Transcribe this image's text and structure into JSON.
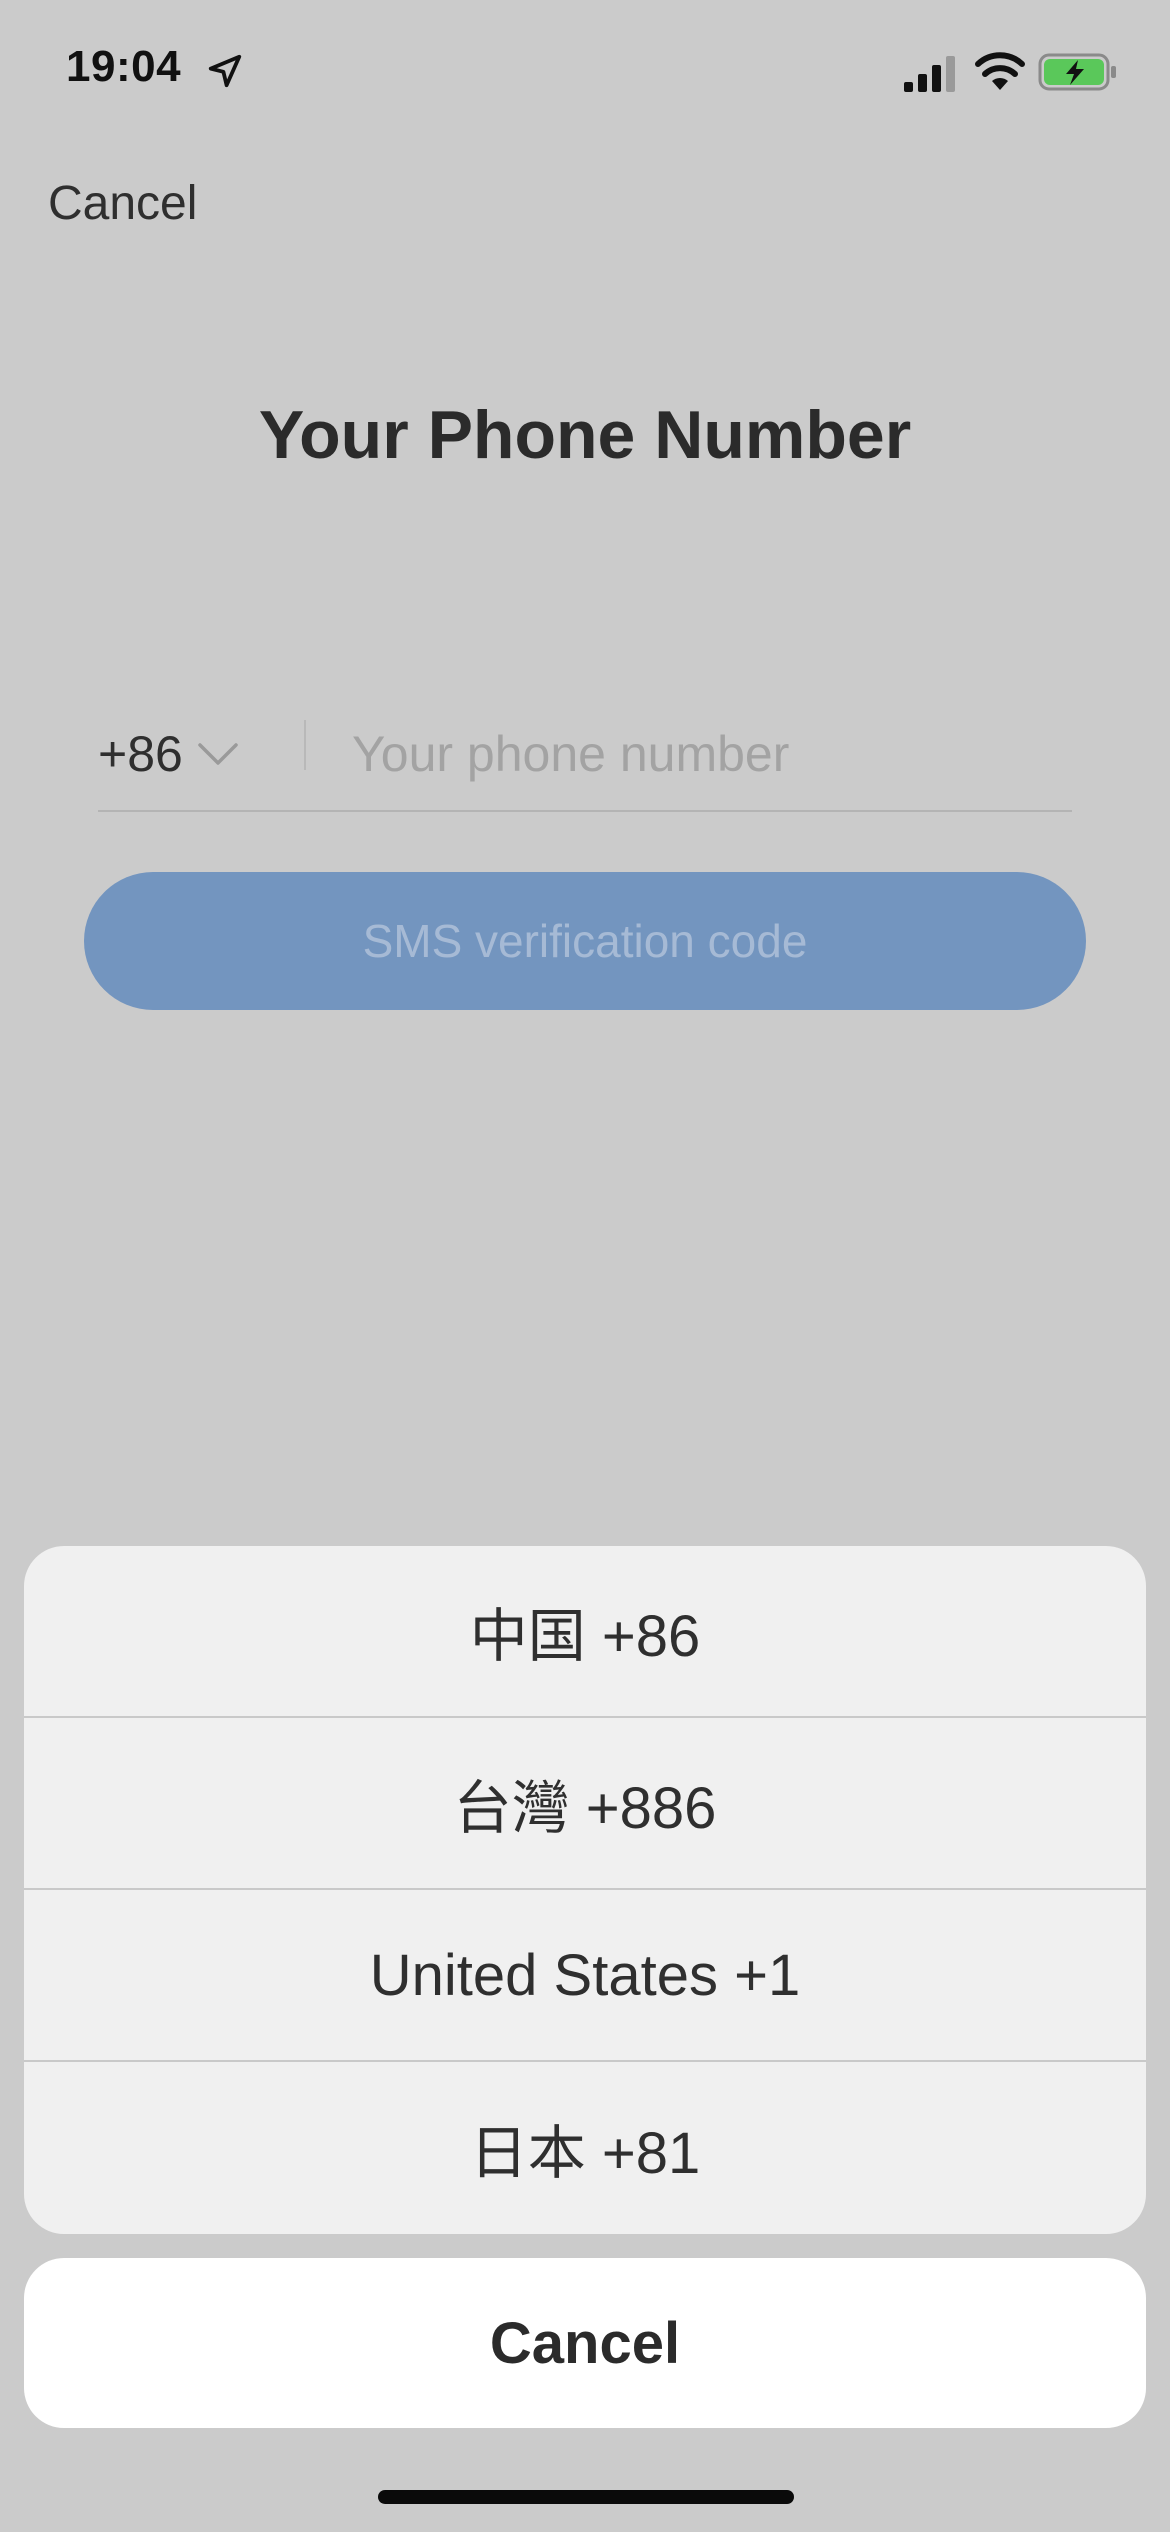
{
  "status_bar": {
    "time": "19:04",
    "icons": [
      "location-arrow-icon",
      "cellular-signal-icon",
      "wifi-icon",
      "battery-charging-icon"
    ],
    "battery_color": "#5ac85a"
  },
  "header": {
    "cancel_label": "Cancel"
  },
  "title": "Your Phone Number",
  "phone_input": {
    "country_code": "+86",
    "placeholder": "Your phone number",
    "value": ""
  },
  "sms_button": {
    "label": "SMS verification code",
    "color": "#7395bf"
  },
  "action_sheet": {
    "options": [
      {
        "label": "中国 +86"
      },
      {
        "label": "台灣 +886"
      },
      {
        "label": "United States +1"
      },
      {
        "label": "日本 +81"
      }
    ],
    "cancel_label": "Cancel"
  }
}
